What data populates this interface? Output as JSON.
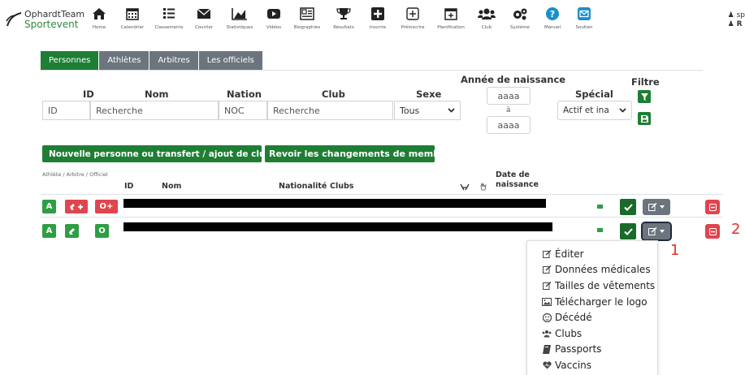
{
  "brand": {
    "line1": "OphardtTeam",
    "line2": "Sportevent"
  },
  "nav": [
    {
      "label": "Home",
      "icon": "home-icon"
    },
    {
      "label": "Calendrier",
      "icon": "calendar-icon"
    },
    {
      "label": "Classements",
      "icon": "list-icon"
    },
    {
      "label": "Courrier",
      "icon": "mail-icon"
    },
    {
      "label": "Statistiques",
      "icon": "chart-icon"
    },
    {
      "label": "Vidéos",
      "icon": "video-icon"
    },
    {
      "label": "Biographies",
      "icon": "biography-icon"
    },
    {
      "label": "Résultats",
      "icon": "trophy-icon"
    },
    {
      "label": "Inscrire",
      "icon": "plus-square-icon"
    },
    {
      "label": "Préinscrire",
      "icon": "plus-box-icon"
    },
    {
      "label": "Planification",
      "icon": "calendar-plus-icon"
    },
    {
      "label": "Club",
      "icon": "users-icon"
    },
    {
      "label": "Système",
      "icon": "gears-icon"
    },
    {
      "label": "Manuel",
      "icon": "help-icon"
    },
    {
      "label": "Soutien",
      "icon": "support-mail-icon"
    }
  ],
  "top_right": {
    "line1": "sp",
    "line2": "R"
  },
  "tabs": [
    "Personnes",
    "Athlètes",
    "Arbitres",
    "Les officiels"
  ],
  "filters": {
    "id_label": "ID",
    "nom_label": "Nom",
    "nation_label": "Nation",
    "club_label": "Club",
    "sexe_label": "Sexe",
    "birth_label": "Année de naissance",
    "special_label": "Spécial",
    "filter_label": "Filtre",
    "id_placeholder": "ID",
    "nom_placeholder": "Recherche",
    "nation_placeholder": "NOC",
    "club_placeholder": "Recherche",
    "sexe_value": "Tous",
    "year_from_placeholder": "aaaa",
    "year_to_text": "à",
    "year_to_placeholder": "aaaa",
    "special_value": "Actif et ina"
  },
  "actions": {
    "new_person": "Nouvelle personne ou transfert / ajout de club",
    "review_changes": "Revoir les changements de membres"
  },
  "table": {
    "role_header": "Athlète / Arbitre / Officiel",
    "id_header": "ID",
    "nom_header": "Nom",
    "nationality_header": "Nationalité",
    "clubs_header": "Clubs",
    "birth_header": "Date de naissance",
    "rows": [
      {
        "btn_a": "A",
        "btn_o": "O",
        "role_colors": [
          "#2e9e45",
          "#e0454f",
          "#e0454f"
        ]
      },
      {
        "btn_a": "A",
        "btn_o": "O",
        "role_colors": [
          "#2e9e45",
          "#2e9e45",
          "#2e9e45"
        ]
      }
    ]
  },
  "annotations": {
    "first": "1",
    "second": "2"
  },
  "menu": [
    {
      "label": "Éditer",
      "icon": "edit-icon"
    },
    {
      "label": "Données médicales",
      "icon": "edit-icon"
    },
    {
      "label": "Tailles de vêtements",
      "icon": "edit-icon"
    },
    {
      "label": "Télécharger le logo",
      "icon": "image-icon"
    },
    {
      "label": "Décédé",
      "icon": "deceased-icon"
    },
    {
      "label": "Clubs",
      "icon": "users-icon"
    },
    {
      "label": "Passports",
      "icon": "passport-icon"
    },
    {
      "label": "Vaccins",
      "icon": "virus-icon"
    }
  ],
  "colors": {
    "green": "#1e7e34",
    "light_green": "#2e9e45",
    "red": "#e0454f",
    "gray": "#6c757d",
    "annotation": "#e0302c"
  }
}
